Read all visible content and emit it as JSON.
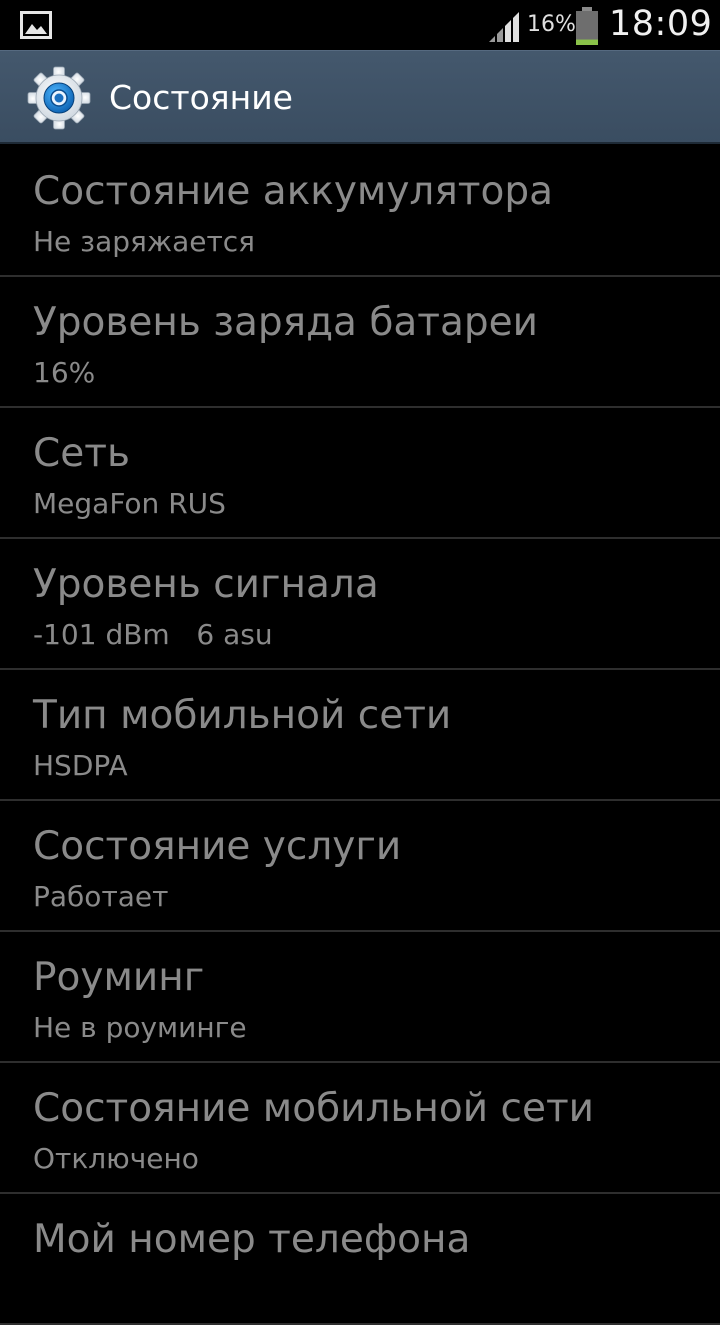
{
  "status_bar": {
    "notification_icon": "image-icon",
    "signal_icon": "signal-icon",
    "battery_percent": "16%",
    "battery_icon": "battery-icon",
    "battery_level": 0.16,
    "battery_color": "#8bc34a",
    "clock": "18:09"
  },
  "action_bar": {
    "icon": "gear-icon",
    "title": "Состояние",
    "background_color": "#44586d"
  },
  "items": [
    {
      "title": "Состояние аккумулятора",
      "value": "Не заряжается"
    },
    {
      "title": "Уровень заряда батареи",
      "value": "16%"
    },
    {
      "title": "Сеть",
      "value": "MegaFon RUS"
    },
    {
      "title": "Уровень сигнала",
      "value": "-101 dBm   6 asu"
    },
    {
      "title": "Тип мобильной сети",
      "value": "HSDPA"
    },
    {
      "title": "Состояние услуги",
      "value": "Работает"
    },
    {
      "title": "Роуминг",
      "value": "Не в роуминге"
    },
    {
      "title": "Состояние мобильной сети",
      "value": "Отключено"
    },
    {
      "title": "Мой номер телефона",
      "value": ""
    }
  ]
}
